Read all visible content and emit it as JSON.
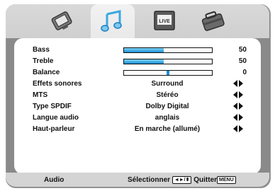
{
  "tabs": [
    {
      "name": "picture",
      "icon": "picture-tab-icon"
    },
    {
      "name": "audio",
      "icon": "music-notes-icon"
    },
    {
      "name": "live",
      "icon": "live-tv-icon",
      "label": "LIVE"
    },
    {
      "name": "setup",
      "icon": "toolbox-icon"
    }
  ],
  "settings": [
    {
      "label": "Bass",
      "kind": "slider",
      "value": 50,
      "max": 100
    },
    {
      "label": "Treble",
      "kind": "slider",
      "value": 50,
      "max": 100
    },
    {
      "label": "Balance",
      "kind": "balance",
      "value": 0,
      "min": -50,
      "max": 50
    },
    {
      "label": "Effets sonores",
      "kind": "select",
      "value": "Surround"
    },
    {
      "label": "MTS",
      "kind": "select",
      "value": "Stéréo"
    },
    {
      "label": "Type SPDIF",
      "kind": "select",
      "value": "Dolby Digital"
    },
    {
      "label": "Langue audio",
      "kind": "select",
      "value": "anglais"
    },
    {
      "label": "Haut-parleur",
      "kind": "select",
      "value": "En marche (allumé)"
    }
  ],
  "footer": {
    "menu_name": "Audio",
    "select_label": "Sélectionner",
    "nav_key": "◄►/⬍",
    "quit_label": "Quitter",
    "menu_key": "MENU"
  },
  "colors": {
    "slider_fill": "#1a8ed6",
    "frame": "#8a8a8a",
    "tab_bar": "#d4d4d4"
  }
}
